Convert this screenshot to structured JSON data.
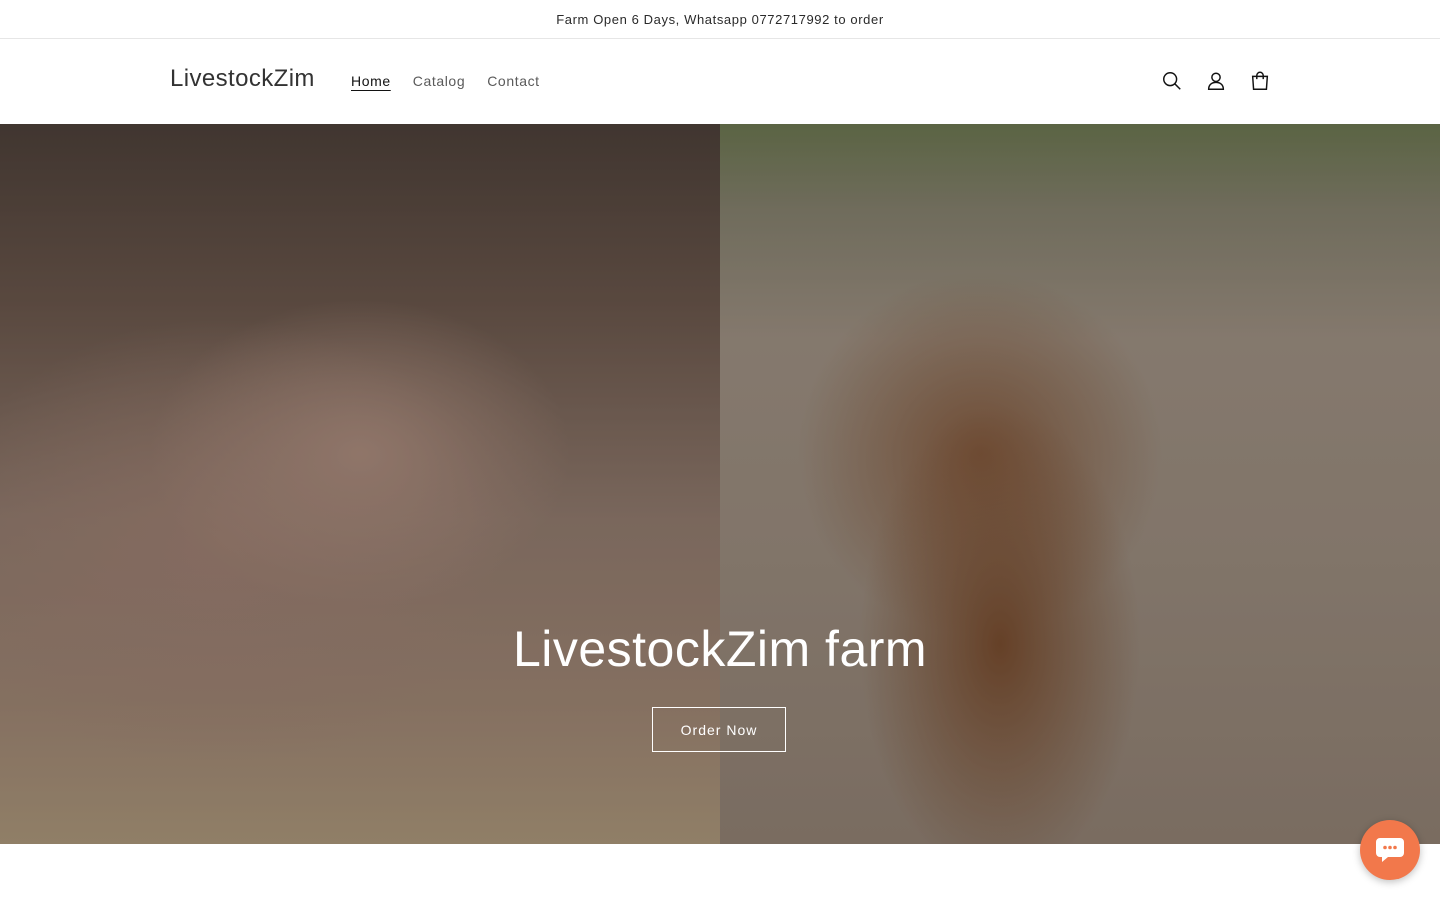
{
  "announcement": {
    "text": "Farm Open 6 Days, Whatsapp 0772717992 to order"
  },
  "header": {
    "logo": "LivestockZim",
    "nav": [
      {
        "label": "Home",
        "active": true
      },
      {
        "label": "Catalog",
        "active": false
      },
      {
        "label": "Contact",
        "active": false
      }
    ],
    "icons": [
      "search-icon",
      "account-icon",
      "cart-icon"
    ]
  },
  "hero": {
    "title": "LivestockZim farm",
    "button_label": "Order Now",
    "images": [
      "pig-photo",
      "goat-photo"
    ]
  },
  "chat": {
    "icon": "chat-icon",
    "color": "#f2784b"
  }
}
